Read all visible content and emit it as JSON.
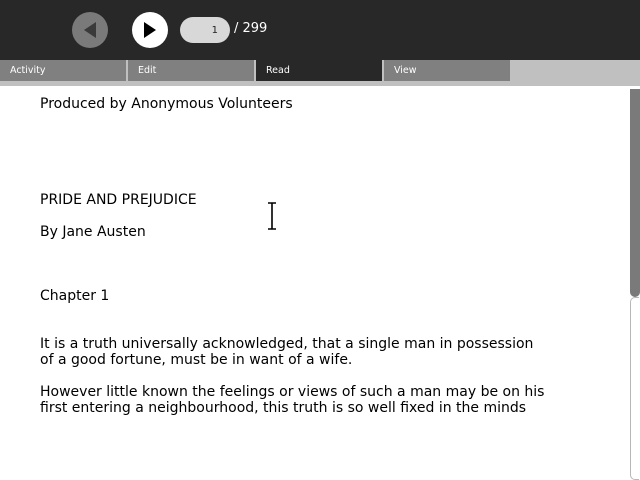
{
  "toolbar": {
    "back_icon": "back-arrow-icon",
    "forward_icon": "forward-arrow-icon",
    "current_page": "1",
    "page_total": "/ 299"
  },
  "tabs": [
    {
      "label": "Activity",
      "active": false
    },
    {
      "label": "Edit",
      "active": false
    },
    {
      "label": "Read",
      "active": true
    },
    {
      "label": "View",
      "active": false
    }
  ],
  "document": {
    "lines": [
      "Produced by Anonymous Volunteers",
      "PRIDE AND PREJUDICE",
      "By Jane Austen",
      "Chapter 1",
      "It is a truth universally acknowledged, that a single man in possession",
      "of a good fortune, must be in want of a wife.",
      "However little known the feelings or views of such a man may be on his",
      "first entering a neighbourhood, this truth is so well fixed in the minds"
    ]
  },
  "colors": {
    "toolbar_bg": "#282828",
    "tab_inactive": "#808080",
    "tab_active": "#282828",
    "tabbar_bg": "#c0c0c0"
  }
}
